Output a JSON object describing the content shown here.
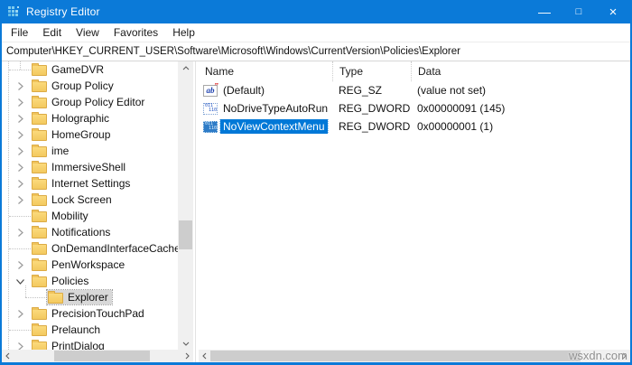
{
  "titlebar": {
    "title": "Registry Editor",
    "minimize": "—",
    "maximize": "□",
    "close": "×"
  },
  "menubar": {
    "items": [
      "File",
      "Edit",
      "View",
      "Favorites",
      "Help"
    ]
  },
  "addressbar": {
    "path": "Computer\\HKEY_CURRENT_USER\\Software\\Microsoft\\Windows\\CurrentVersion\\Policies\\Explorer"
  },
  "tree": {
    "items": [
      {
        "label": "GameDVR",
        "state": "leaf",
        "depth": 0,
        "selected": false
      },
      {
        "label": "Group Policy",
        "state": "collapsed",
        "depth": 0,
        "selected": false
      },
      {
        "label": "Group Policy Editor",
        "state": "collapsed",
        "depth": 0,
        "selected": false
      },
      {
        "label": "Holographic",
        "state": "collapsed",
        "depth": 0,
        "selected": false
      },
      {
        "label": "HomeGroup",
        "state": "collapsed",
        "depth": 0,
        "selected": false
      },
      {
        "label": "ime",
        "state": "collapsed",
        "depth": 0,
        "selected": false
      },
      {
        "label": "ImmersiveShell",
        "state": "collapsed",
        "depth": 0,
        "selected": false
      },
      {
        "label": "Internet Settings",
        "state": "collapsed",
        "depth": 0,
        "selected": false
      },
      {
        "label": "Lock Screen",
        "state": "collapsed",
        "depth": 0,
        "selected": false
      },
      {
        "label": "Mobility",
        "state": "leaf",
        "depth": 0,
        "selected": false
      },
      {
        "label": "Notifications",
        "state": "collapsed",
        "depth": 0,
        "selected": false
      },
      {
        "label": "OnDemandInterfaceCache",
        "state": "leaf",
        "depth": 0,
        "selected": false
      },
      {
        "label": "PenWorkspace",
        "state": "collapsed",
        "depth": 0,
        "selected": false
      },
      {
        "label": "Policies",
        "state": "expanded",
        "depth": 0,
        "selected": false
      },
      {
        "label": "Explorer",
        "state": "leaf",
        "depth": 1,
        "selected": true
      },
      {
        "label": "PrecisionTouchPad",
        "state": "collapsed",
        "depth": 0,
        "selected": false
      },
      {
        "label": "Prelaunch",
        "state": "leaf",
        "depth": 0,
        "selected": false
      },
      {
        "label": "PrintDialog",
        "state": "collapsed",
        "depth": 0,
        "selected": false
      }
    ]
  },
  "list": {
    "columns": [
      "Name",
      "Type",
      "Data"
    ],
    "rows": [
      {
        "icon": "string-value-icon",
        "name": "(Default)",
        "type": "REG_SZ",
        "data": "(value not set)",
        "selected": false
      },
      {
        "icon": "dword-value-icon",
        "name": "NoDriveTypeAutoRun",
        "type": "REG_DWORD",
        "data": "0x00000091 (145)",
        "selected": false
      },
      {
        "icon": "dword-value-icon",
        "name": "NoViewContextMenu",
        "type": "REG_DWORD",
        "data": "0x00000001 (1)",
        "selected": true
      }
    ]
  },
  "icon_glyphs": {
    "string": "ab",
    "dword_top": "011",
    "dword_bottom": "110"
  },
  "watermark": "wsxdn.com",
  "colors": {
    "titlebar_blue": "#0b7ad8",
    "selection_blue": "#0078d7",
    "inactive_selection_gray": "#d8d8d8",
    "folder_yellow": "#f7d070"
  }
}
